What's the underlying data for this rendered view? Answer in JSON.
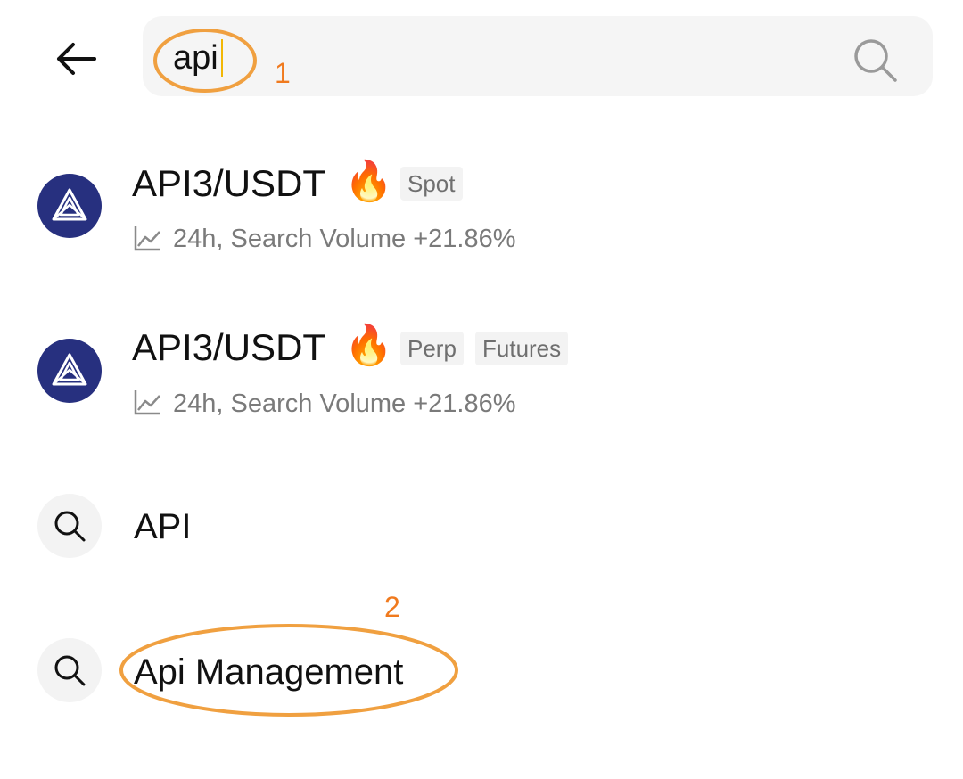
{
  "search": {
    "value": "api"
  },
  "results": [
    {
      "pair": "API3/USDT",
      "hot_emoji": "🔥",
      "tags": [
        "Spot"
      ],
      "trend_text": "24h, Search Volume +21.86%"
    },
    {
      "pair": "API3/USDT",
      "hot_emoji": "🔥",
      "tags": [
        "Perp",
        "Futures"
      ],
      "trend_text": "24h, Search Volume +21.86%"
    }
  ],
  "suggestions": [
    {
      "label": "API"
    },
    {
      "label": "Api Management"
    }
  ],
  "annotations": [
    {
      "number": "1"
    },
    {
      "number": "2"
    }
  ],
  "colors": {
    "annotation": "#f0a040",
    "annotation_number": "#f07a1e",
    "coin_avatar_bg": "#27307f",
    "search_bar_bg": "#f5f5f5",
    "caret": "#f2b705"
  },
  "icons": {
    "back": "arrow-left-icon",
    "search": "magnifier-icon",
    "trend": "trend-line-icon",
    "coin": "api3-logo-icon"
  }
}
